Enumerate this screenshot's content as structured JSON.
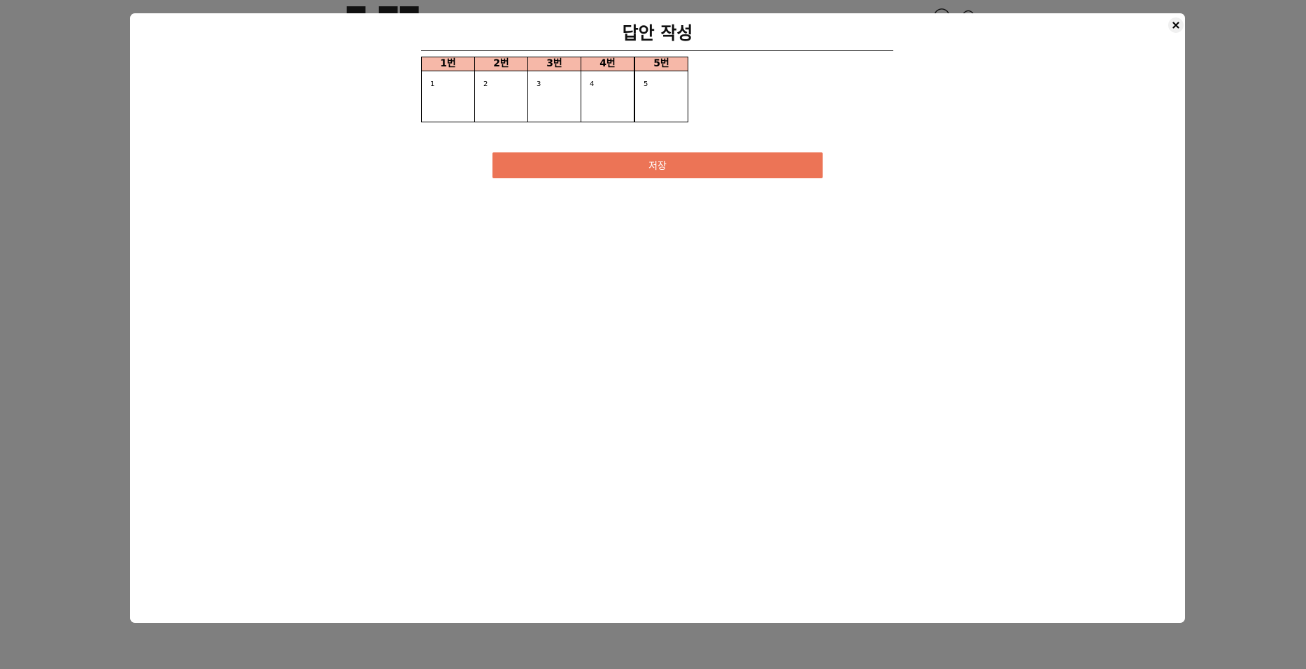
{
  "modal": {
    "title": "답안 작성",
    "close_icon": "close-icon"
  },
  "answers": [
    {
      "header": "1번",
      "value": "1"
    },
    {
      "header": "2번",
      "value": "2"
    },
    {
      "header": "3번",
      "value": "3"
    },
    {
      "header": "4번",
      "value": "4"
    },
    {
      "header": "5번",
      "value": "5"
    }
  ],
  "save_label": "저장",
  "colors": {
    "header_bg": "#f6b8a8",
    "save_bg": "#ec7456",
    "overlay": "#7f7f7f"
  }
}
